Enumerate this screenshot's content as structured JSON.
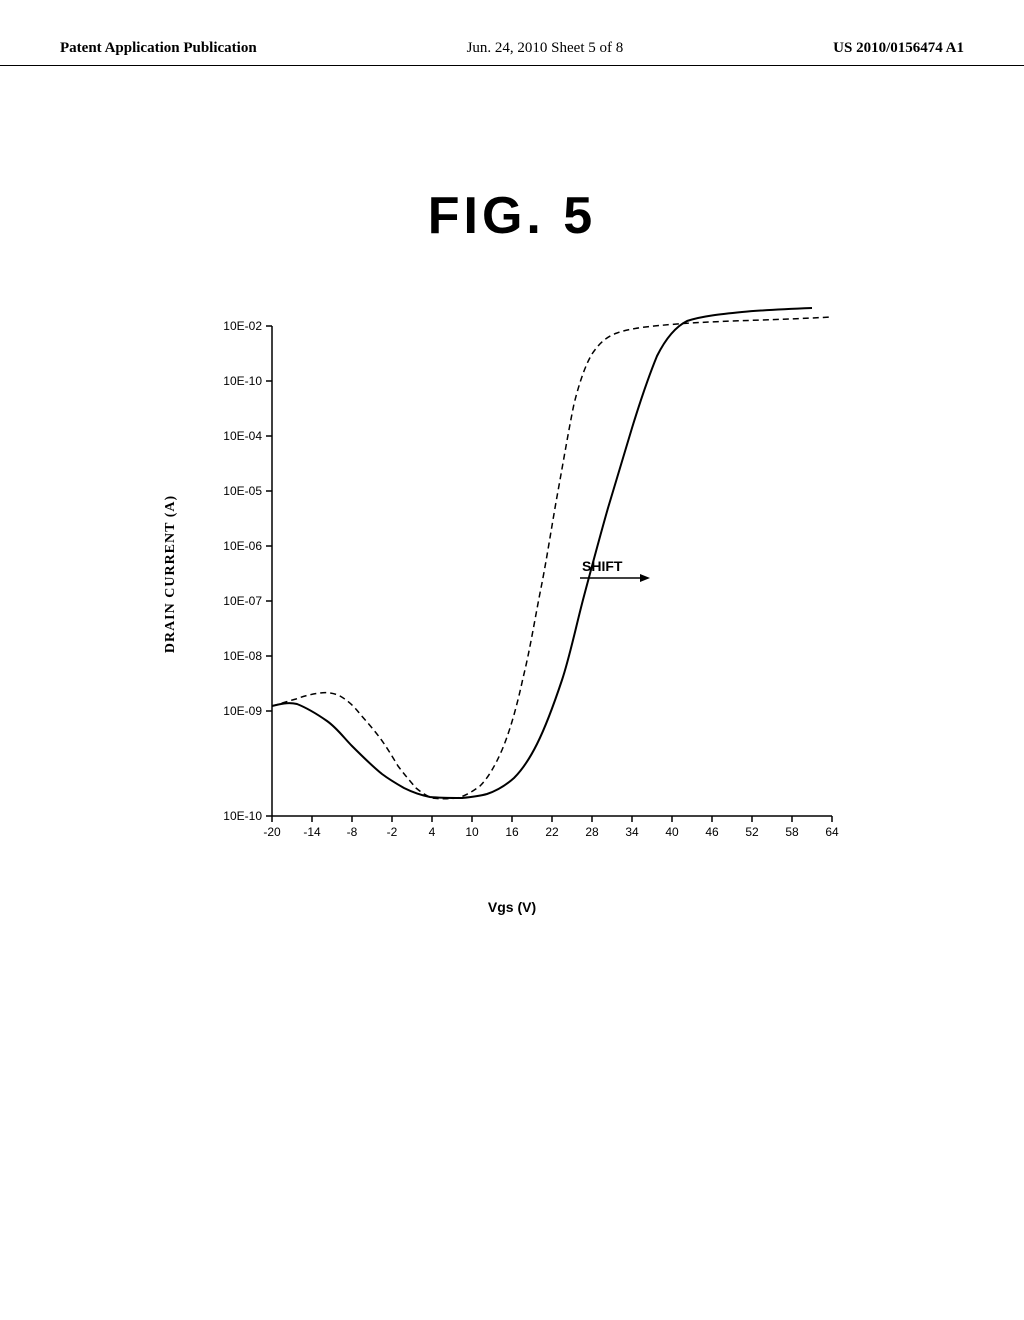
{
  "header": {
    "left": "Patent Application Publication",
    "center": "Jun. 24, 2010  Sheet 5 of 8",
    "right": "US 2010/0156474 A1"
  },
  "figure": {
    "title": "FIG.  5"
  },
  "chart": {
    "y_axis_label": "DRAIN CURRENT (A)",
    "x_axis_label": "Vgs (V)",
    "y_ticks": [
      "10E-02",
      "10E-10",
      "10E-04",
      "10E-05",
      "10E-06",
      "10E-07",
      "10E-08",
      "10E-09",
      "10E-10"
    ],
    "x_ticks": [
      "-20",
      "-14",
      "-8",
      "-2",
      "4",
      "10",
      "16",
      "22",
      "28",
      "34",
      "40",
      "46",
      "52",
      "58",
      "64"
    ],
    "shift_label": "SHIFT"
  }
}
